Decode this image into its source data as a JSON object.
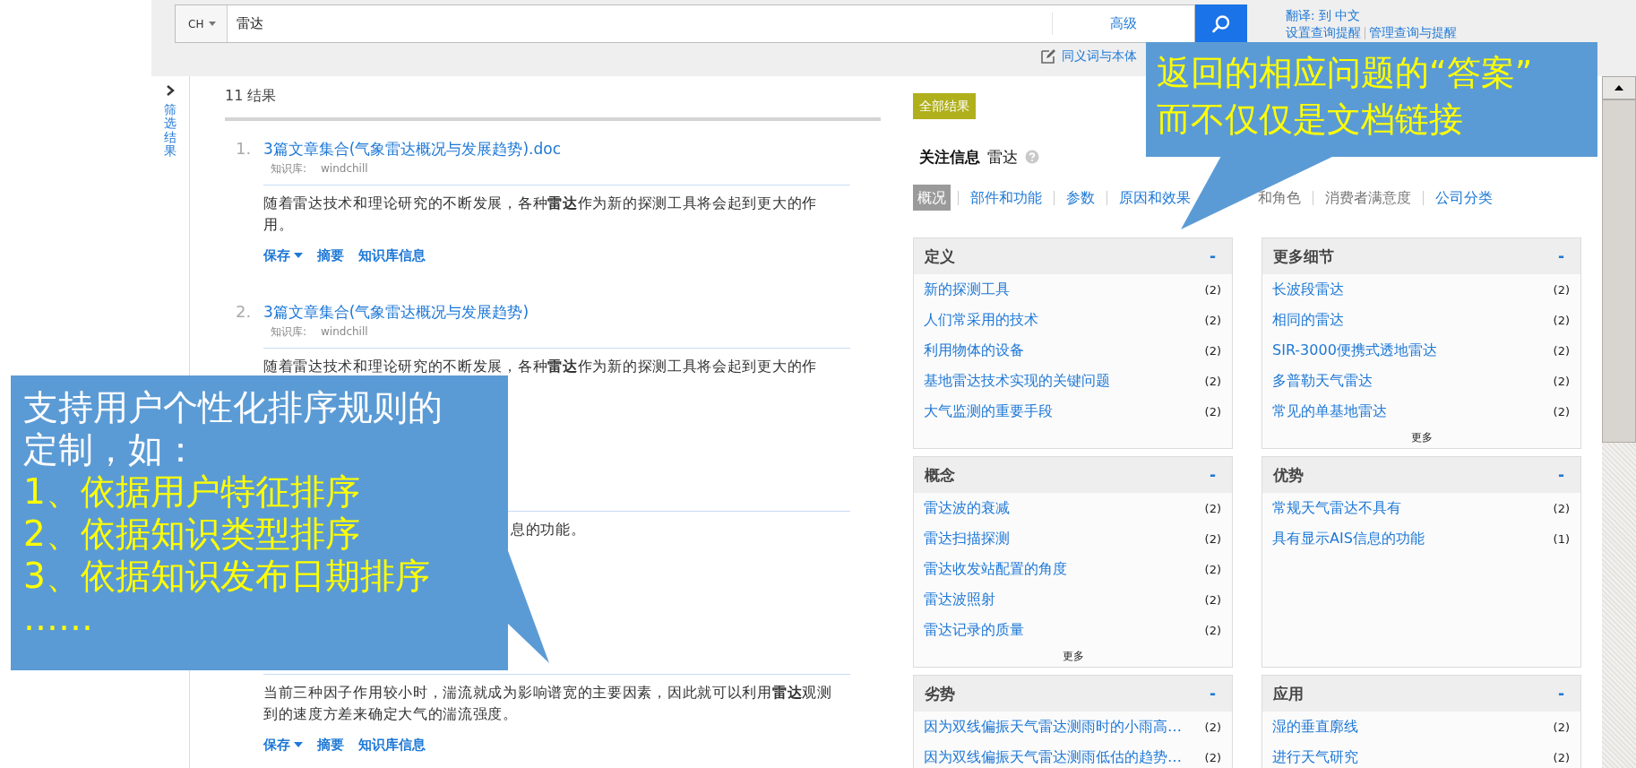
{
  "search": {
    "language": "CH",
    "value": "雷达",
    "advanced": "高级"
  },
  "top_links": {
    "translate": "翻译: 到 中文",
    "alerts": [
      "设置查询提醒",
      "管理查询与提醒"
    ],
    "synonyms": "同义词与本体"
  },
  "sidebar": {
    "label": "筛选结果"
  },
  "results": {
    "count": "11 结果",
    "items": [
      {
        "number": "1.",
        "title": "3篇文章集合(气象雷达概况与发展趋势).doc",
        "meta_label": "知识库:",
        "meta_value": "windchill",
        "snippet": "随着雷达技术和理论研究的不断发展，各种**雷达**作为新的探测工具将会起到更大的作用。",
        "actions": [
          "保存",
          "摘要",
          "知识库信息"
        ]
      },
      {
        "number": "2.",
        "title": "3篇文章集合(气象雷达概况与发展趋势)",
        "meta_label": "知识库:",
        "meta_value": "windchill",
        "snippet": "随着雷达技术和理论研究的不断发展，各种**雷达**作为新的探测工具将会起到更大的作"
      },
      {
        "snippet": "息的功能。",
        "snippet_clipped": true
      },
      {
        "snippet": "当前三种因子作用较小时，湍流就成为影响谱宽的主要因素，因此就可以利用**雷达**观测到的速度方差来确定大气的湍流强度。",
        "actions": [
          "保存",
          "摘要",
          "知识库信息"
        ]
      }
    ]
  },
  "focus": {
    "badge": "全部结果",
    "title": "关注信息",
    "term": "雷达",
    "tabs": [
      {
        "label": "概况",
        "selected": true,
        "disabled": false
      },
      {
        "label": "部件和功能",
        "selected": false,
        "disabled": false
      },
      {
        "label": "参数",
        "selected": false,
        "disabled": false
      },
      {
        "label": "原因和效果",
        "selected": false,
        "disabled": false
      },
      {
        "label": "和角色",
        "selected": false,
        "disabled": true,
        "clipped": true
      },
      {
        "label": "消费者满意度",
        "selected": false,
        "disabled": true
      },
      {
        "label": "公司分类",
        "selected": false,
        "disabled": false
      }
    ],
    "boxes": [
      {
        "title": "定义",
        "collapse": "-",
        "items": [
          {
            "label": "新的探测工具",
            "count": "(2)"
          },
          {
            "label": "人们常采用的技术",
            "count": "(2)"
          },
          {
            "label": "利用物体的设备",
            "count": "(2)"
          },
          {
            "label": "基地雷达技术实现的关键问题",
            "count": "(2)"
          },
          {
            "label": "大气监测的重要手段",
            "count": "(2)"
          }
        ]
      },
      {
        "title": "更多细节",
        "collapse": "-",
        "items": [
          {
            "label": "长波段雷达",
            "count": "(2)"
          },
          {
            "label": "相同的雷达",
            "count": "(2)"
          },
          {
            "label": "SIR-3000便携式透地雷达",
            "count": "(2)"
          },
          {
            "label": "多普勒天气雷达",
            "count": "(2)"
          },
          {
            "label": "常见的单基地雷达",
            "count": "(2)"
          }
        ],
        "more": "更多"
      },
      {
        "title": "概念",
        "collapse": "-",
        "items": [
          {
            "label": "雷达波的衰减",
            "count": "(2)"
          },
          {
            "label": "雷达扫描探测",
            "count": "(2)"
          },
          {
            "label": "雷达收发站配置的角度",
            "count": "(2)"
          },
          {
            "label": "雷达波照射",
            "count": "(2)"
          },
          {
            "label": "雷达记录的质量",
            "count": "(2)"
          }
        ],
        "more": "更多"
      },
      {
        "title": "优势",
        "collapse": "-",
        "items": [
          {
            "label": "常规天气雷达不具有",
            "count": "(2)"
          },
          {
            "label": "具有显示AIS信息的功能",
            "count": "(1)"
          }
        ]
      },
      {
        "title": "劣势",
        "collapse": "-",
        "items": [
          {
            "label": "因为双线偏振天气雷达测雨时的小雨高…",
            "count": "(2)"
          },
          {
            "label": "因为双线偏振天气雷达测雨低估的趋势…",
            "count": "(2)"
          }
        ]
      },
      {
        "title": "应用",
        "collapse": "-",
        "items": [
          {
            "label": "湿的垂直廓线",
            "count": "(2)"
          },
          {
            "label": "进行天气研究",
            "count": "(2)"
          }
        ]
      }
    ]
  },
  "callouts": [
    {
      "lines": [
        {
          "text": "支持用户个性化排序规则的",
          "kind": "plain"
        },
        {
          "text": "定制，如：",
          "kind": "plain"
        },
        {
          "text": "1、依据用户特征排序",
          "kind": "highlight"
        },
        {
          "text": "2、依据知识类型排序",
          "kind": "highlight"
        },
        {
          "text": "3、依据知识发布日期排序",
          "kind": "highlight"
        },
        {
          "text": "……",
          "kind": "highlight"
        }
      ]
    },
    {
      "lines": [
        {
          "text": "返回的相应问题的“答案”",
          "kind": "highlight"
        },
        {
          "text": "而不仅仅是文档链接",
          "kind": "highlight"
        }
      ]
    }
  ]
}
